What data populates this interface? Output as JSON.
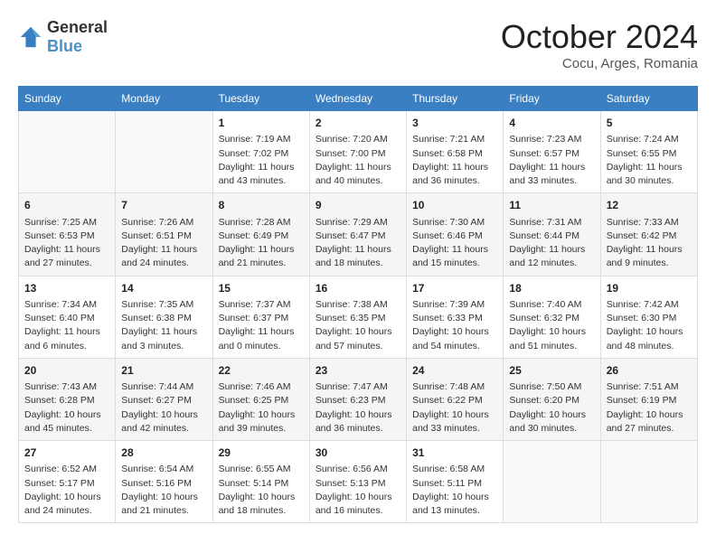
{
  "logo": {
    "general": "General",
    "blue": "Blue"
  },
  "title": "October 2024",
  "subtitle": "Cocu, Arges, Romania",
  "days_of_week": [
    "Sunday",
    "Monday",
    "Tuesday",
    "Wednesday",
    "Thursday",
    "Friday",
    "Saturday"
  ],
  "weeks": [
    [
      {
        "day": "",
        "sunrise": "",
        "sunset": "",
        "daylight": ""
      },
      {
        "day": "",
        "sunrise": "",
        "sunset": "",
        "daylight": ""
      },
      {
        "day": "1",
        "sunrise": "Sunrise: 7:19 AM",
        "sunset": "Sunset: 7:02 PM",
        "daylight": "Daylight: 11 hours and 43 minutes."
      },
      {
        "day": "2",
        "sunrise": "Sunrise: 7:20 AM",
        "sunset": "Sunset: 7:00 PM",
        "daylight": "Daylight: 11 hours and 40 minutes."
      },
      {
        "day": "3",
        "sunrise": "Sunrise: 7:21 AM",
        "sunset": "Sunset: 6:58 PM",
        "daylight": "Daylight: 11 hours and 36 minutes."
      },
      {
        "day": "4",
        "sunrise": "Sunrise: 7:23 AM",
        "sunset": "Sunset: 6:57 PM",
        "daylight": "Daylight: 11 hours and 33 minutes."
      },
      {
        "day": "5",
        "sunrise": "Sunrise: 7:24 AM",
        "sunset": "Sunset: 6:55 PM",
        "daylight": "Daylight: 11 hours and 30 minutes."
      }
    ],
    [
      {
        "day": "6",
        "sunrise": "Sunrise: 7:25 AM",
        "sunset": "Sunset: 6:53 PM",
        "daylight": "Daylight: 11 hours and 27 minutes."
      },
      {
        "day": "7",
        "sunrise": "Sunrise: 7:26 AM",
        "sunset": "Sunset: 6:51 PM",
        "daylight": "Daylight: 11 hours and 24 minutes."
      },
      {
        "day": "8",
        "sunrise": "Sunrise: 7:28 AM",
        "sunset": "Sunset: 6:49 PM",
        "daylight": "Daylight: 11 hours and 21 minutes."
      },
      {
        "day": "9",
        "sunrise": "Sunrise: 7:29 AM",
        "sunset": "Sunset: 6:47 PM",
        "daylight": "Daylight: 11 hours and 18 minutes."
      },
      {
        "day": "10",
        "sunrise": "Sunrise: 7:30 AM",
        "sunset": "Sunset: 6:46 PM",
        "daylight": "Daylight: 11 hours and 15 minutes."
      },
      {
        "day": "11",
        "sunrise": "Sunrise: 7:31 AM",
        "sunset": "Sunset: 6:44 PM",
        "daylight": "Daylight: 11 hours and 12 minutes."
      },
      {
        "day": "12",
        "sunrise": "Sunrise: 7:33 AM",
        "sunset": "Sunset: 6:42 PM",
        "daylight": "Daylight: 11 hours and 9 minutes."
      }
    ],
    [
      {
        "day": "13",
        "sunrise": "Sunrise: 7:34 AM",
        "sunset": "Sunset: 6:40 PM",
        "daylight": "Daylight: 11 hours and 6 minutes."
      },
      {
        "day": "14",
        "sunrise": "Sunrise: 7:35 AM",
        "sunset": "Sunset: 6:38 PM",
        "daylight": "Daylight: 11 hours and 3 minutes."
      },
      {
        "day": "15",
        "sunrise": "Sunrise: 7:37 AM",
        "sunset": "Sunset: 6:37 PM",
        "daylight": "Daylight: 11 hours and 0 minutes."
      },
      {
        "day": "16",
        "sunrise": "Sunrise: 7:38 AM",
        "sunset": "Sunset: 6:35 PM",
        "daylight": "Daylight: 10 hours and 57 minutes."
      },
      {
        "day": "17",
        "sunrise": "Sunrise: 7:39 AM",
        "sunset": "Sunset: 6:33 PM",
        "daylight": "Daylight: 10 hours and 54 minutes."
      },
      {
        "day": "18",
        "sunrise": "Sunrise: 7:40 AM",
        "sunset": "Sunset: 6:32 PM",
        "daylight": "Daylight: 10 hours and 51 minutes."
      },
      {
        "day": "19",
        "sunrise": "Sunrise: 7:42 AM",
        "sunset": "Sunset: 6:30 PM",
        "daylight": "Daylight: 10 hours and 48 minutes."
      }
    ],
    [
      {
        "day": "20",
        "sunrise": "Sunrise: 7:43 AM",
        "sunset": "Sunset: 6:28 PM",
        "daylight": "Daylight: 10 hours and 45 minutes."
      },
      {
        "day": "21",
        "sunrise": "Sunrise: 7:44 AM",
        "sunset": "Sunset: 6:27 PM",
        "daylight": "Daylight: 10 hours and 42 minutes."
      },
      {
        "day": "22",
        "sunrise": "Sunrise: 7:46 AM",
        "sunset": "Sunset: 6:25 PM",
        "daylight": "Daylight: 10 hours and 39 minutes."
      },
      {
        "day": "23",
        "sunrise": "Sunrise: 7:47 AM",
        "sunset": "Sunset: 6:23 PM",
        "daylight": "Daylight: 10 hours and 36 minutes."
      },
      {
        "day": "24",
        "sunrise": "Sunrise: 7:48 AM",
        "sunset": "Sunset: 6:22 PM",
        "daylight": "Daylight: 10 hours and 33 minutes."
      },
      {
        "day": "25",
        "sunrise": "Sunrise: 7:50 AM",
        "sunset": "Sunset: 6:20 PM",
        "daylight": "Daylight: 10 hours and 30 minutes."
      },
      {
        "day": "26",
        "sunrise": "Sunrise: 7:51 AM",
        "sunset": "Sunset: 6:19 PM",
        "daylight": "Daylight: 10 hours and 27 minutes."
      }
    ],
    [
      {
        "day": "27",
        "sunrise": "Sunrise: 6:52 AM",
        "sunset": "Sunset: 5:17 PM",
        "daylight": "Daylight: 10 hours and 24 minutes."
      },
      {
        "day": "28",
        "sunrise": "Sunrise: 6:54 AM",
        "sunset": "Sunset: 5:16 PM",
        "daylight": "Daylight: 10 hours and 21 minutes."
      },
      {
        "day": "29",
        "sunrise": "Sunrise: 6:55 AM",
        "sunset": "Sunset: 5:14 PM",
        "daylight": "Daylight: 10 hours and 18 minutes."
      },
      {
        "day": "30",
        "sunrise": "Sunrise: 6:56 AM",
        "sunset": "Sunset: 5:13 PM",
        "daylight": "Daylight: 10 hours and 16 minutes."
      },
      {
        "day": "31",
        "sunrise": "Sunrise: 6:58 AM",
        "sunset": "Sunset: 5:11 PM",
        "daylight": "Daylight: 10 hours and 13 minutes."
      },
      {
        "day": "",
        "sunrise": "",
        "sunset": "",
        "daylight": ""
      },
      {
        "day": "",
        "sunrise": "",
        "sunset": "",
        "daylight": ""
      }
    ]
  ]
}
